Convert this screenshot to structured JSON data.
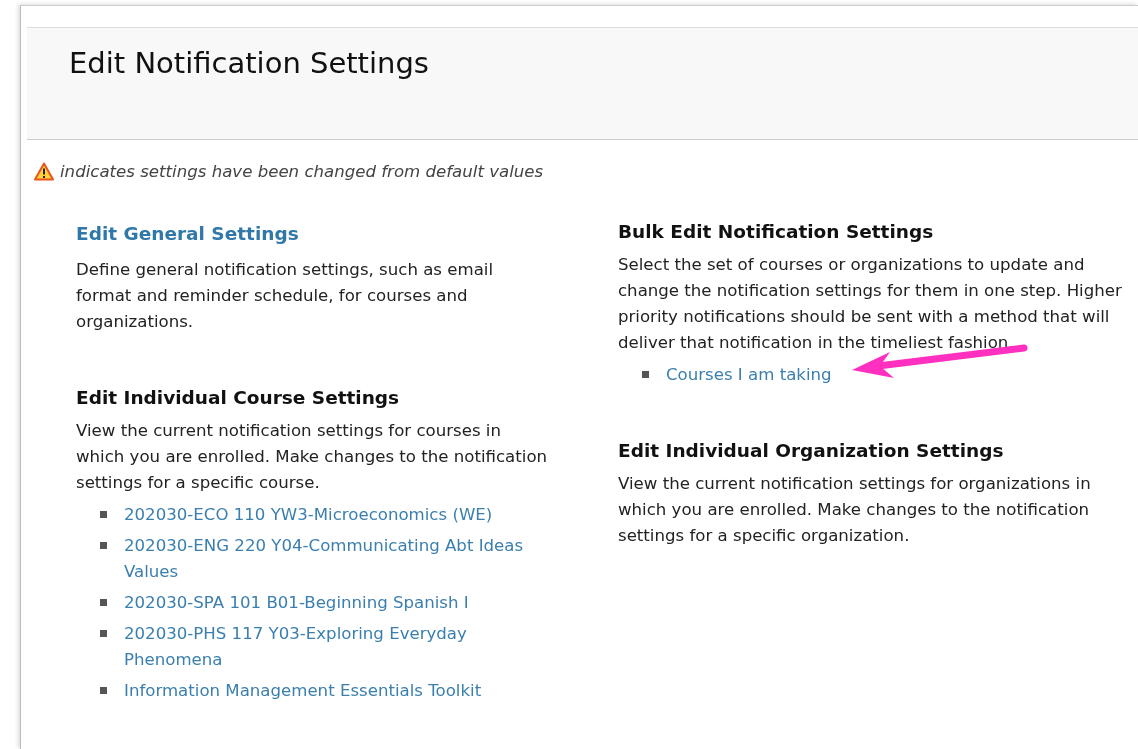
{
  "page": {
    "title": "Edit Notification Settings",
    "legend": "indicates settings have been changed from default values"
  },
  "columns": [
    {
      "sections": [
        {
          "kind": "link",
          "title": "Edit General Settings",
          "description": "Define general notification settings, such as email format and reminder schedule, for courses and organizations."
        },
        {
          "kind": "heading",
          "title": "Edit Individual Course Settings",
          "description": "View the current notification settings for courses in which you are enrolled. Make changes to the notification settings for a specific course.",
          "links": [
            {
              "label": "202030-ECO 110 YW3-Microeconomics (WE)",
              "annotated": false
            },
            {
              "label": "202030-ENG 220 Y04-Communicating Abt Ideas Values",
              "annotated": false
            },
            {
              "label": "202030-SPA 101 B01-Beginning Spanish I",
              "annotated": false
            },
            {
              "label": "202030-PHS 117 Y03-Exploring Everyday Phenomena",
              "annotated": false
            },
            {
              "label": "Information Management Essentials Toolkit",
              "annotated": false
            }
          ]
        }
      ]
    },
    {
      "sections": [
        {
          "kind": "heading",
          "title": "Bulk Edit Notification Settings",
          "description": "Select the set of courses or organizations to update and change the notification settings for them in one step. Higher priority notifications should be sent with a method that will deliver that notification in the timeliest fashion.",
          "links": [
            {
              "label": "Courses I am taking",
              "annotated": true
            }
          ]
        },
        {
          "kind": "heading",
          "title": "Edit Individual Organization Settings",
          "description": "View the current notification settings for organizations in which you are enrolled. Make changes to the notification settings for a specific organization."
        }
      ]
    }
  ]
}
